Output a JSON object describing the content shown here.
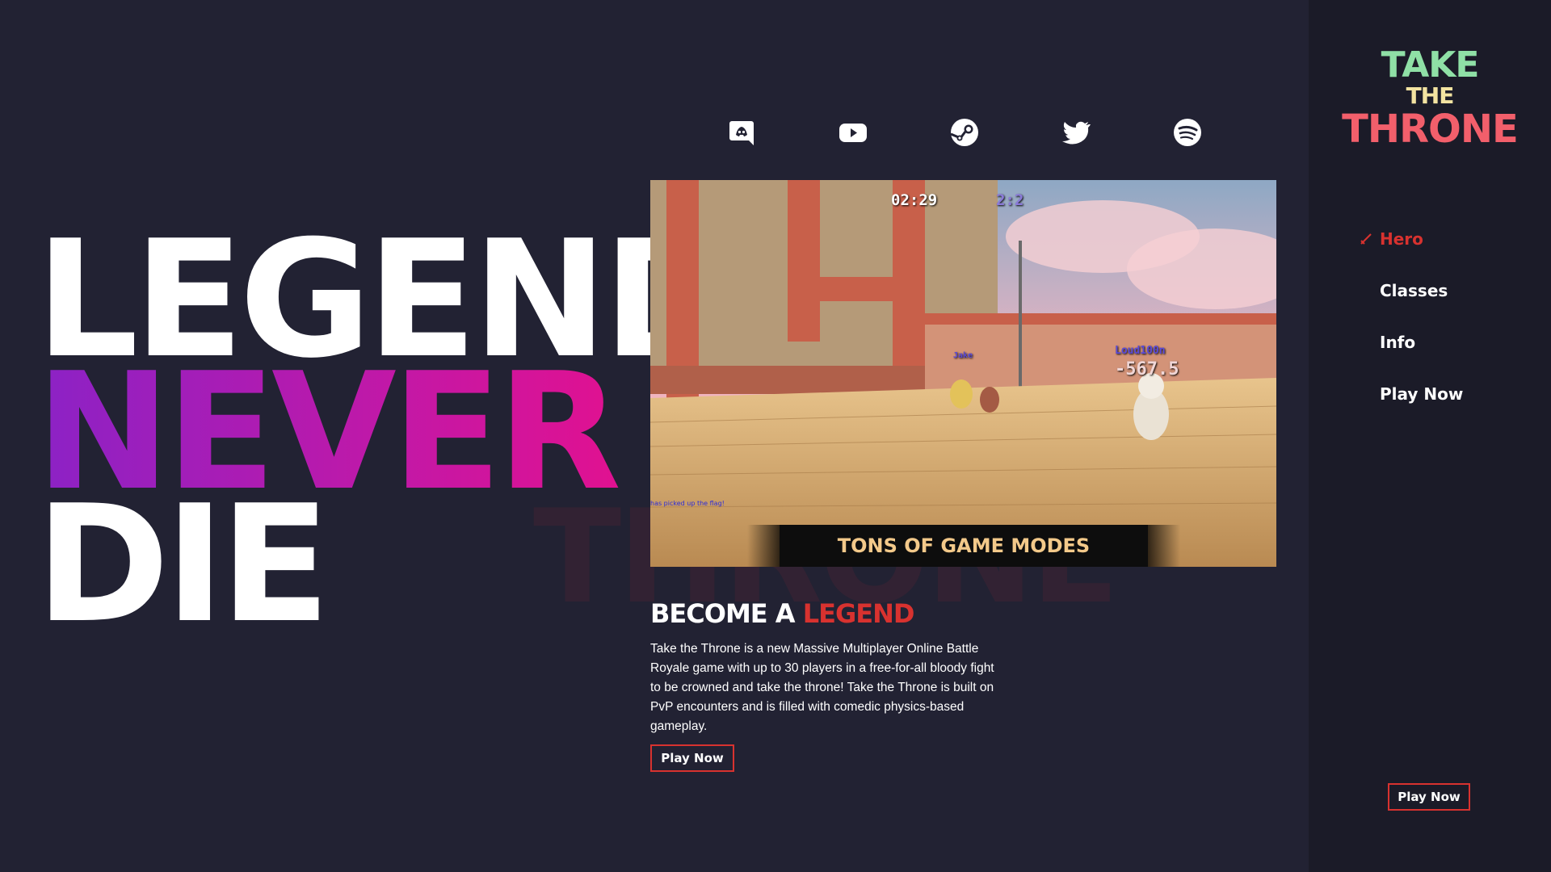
{
  "brand": {
    "logo_line1": "TAKE",
    "logo_line2": "THE",
    "logo_line3": "THRONE",
    "accent_color": "#d8322f"
  },
  "hero": {
    "line1": "LEGENDS",
    "line2": "NEVER",
    "line3": "DIE",
    "watermark": "THRONE"
  },
  "social": [
    {
      "icon": "discord-icon"
    },
    {
      "icon": "youtube-icon"
    },
    {
      "icon": "steam-icon"
    },
    {
      "icon": "twitter-icon"
    },
    {
      "icon": "spotify-icon"
    }
  ],
  "video": {
    "timer": "02:29",
    "score": "2:2",
    "player1_name": "Loud100n",
    "player1_value": "-567.5",
    "player2_name": "Jake",
    "caption": "TONS OF GAME MODES",
    "feed": "has picked up the flag!"
  },
  "info": {
    "title_prefix": "BECOME A ",
    "title_accent": "LEGEND",
    "description": "Take the Throne is a new Massive Multiplayer Online Battle Royale game with up to 30 players in a free-for-all bloody fight to be crowned and take the throne! Take the Throne is built on PvP encounters and is filled with comedic physics-based gameplay.",
    "play_label": "Play Now"
  },
  "nav": {
    "items": [
      {
        "label": "Hero",
        "active": true
      },
      {
        "label": "Classes",
        "active": false
      },
      {
        "label": "Info",
        "active": false
      },
      {
        "label": "Play Now",
        "active": false
      }
    ],
    "play_label": "Play Now"
  }
}
